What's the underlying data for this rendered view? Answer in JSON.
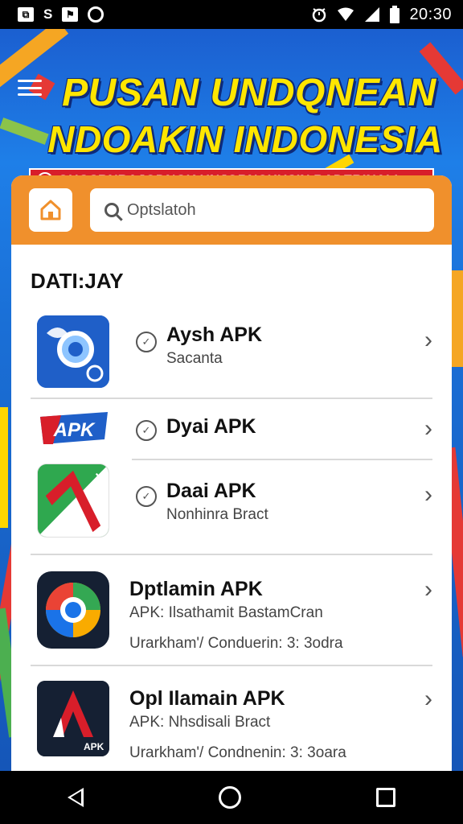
{
  "status_bar": {
    "left_icons": [
      "image-icon",
      "s-icon",
      "flag-icon",
      "record-icon"
    ],
    "left_glyphs": [
      "⧉",
      "S",
      "⚑",
      ""
    ],
    "right_icons": [
      "alarm-icon",
      "wifi-icon",
      "signal-icon",
      "battery-icon"
    ],
    "time": "20:30"
  },
  "banner": {
    "title_line1": "PUSAN UNDQNEAN",
    "title_line2": "NDOAKIN INDONESIA",
    "ribbon_text": "OUGSRNRAJODNGK UNJORNCHUSIN BADEBINALI"
  },
  "header": {
    "home_icon": "home-icon",
    "search_placeholder": "Optslatoh"
  },
  "section": {
    "title": "DATI:JAY"
  },
  "apps": [
    {
      "name": "Aysh APK",
      "line1": "Sacanta",
      "line2": ""
    },
    {
      "name": "Dyai APK",
      "line1": "",
      "line2": ""
    },
    {
      "name": "Daai APK",
      "line1": "Nonhinra Bract",
      "line2": ""
    },
    {
      "name": "Dptlamin APK",
      "line1": "APK: Ilsathamit BastamCran",
      "line2": "Urarkham'/ Conduerin: 3: 3odra"
    },
    {
      "name": "Opl Ilamain APK",
      "line1": "APK: Nhsdisali Bract",
      "line2": "Urarkham'/ Condnenin: 3: 3oara"
    }
  ],
  "icon_labels": {
    "apk_badge": "APK",
    "apk_small": "APK"
  },
  "colors": {
    "accent_orange": "#f0902c",
    "banner_blue": "#1a6fd6",
    "title_yellow": "#ffe600",
    "ribbon_red": "#d81e2a"
  },
  "nav": {
    "buttons": [
      "back-button",
      "home-button",
      "recents-button"
    ]
  }
}
